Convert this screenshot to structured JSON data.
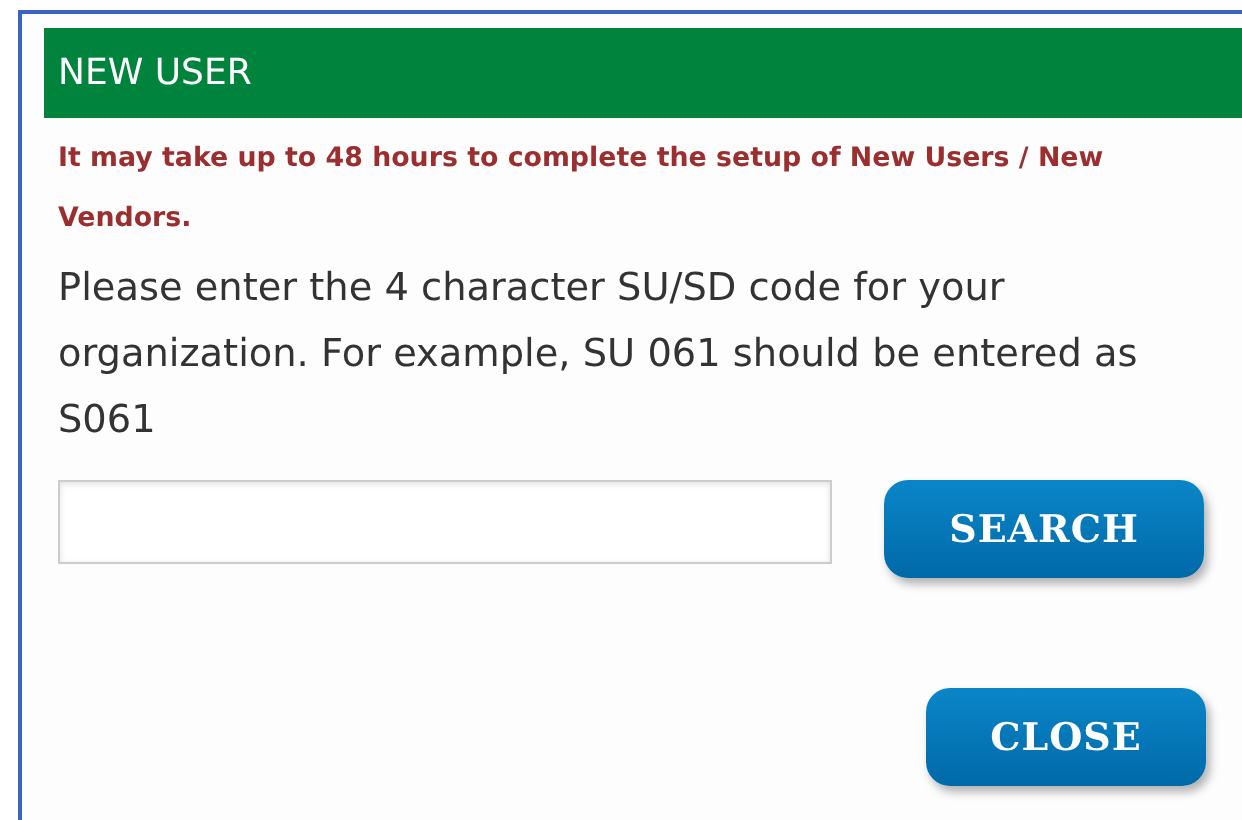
{
  "dialog": {
    "title": "NEW USER",
    "notice": "It may take up to 48 hours to complete the setup of New Users / New Vendors.",
    "instructions": "Please enter the 4 character SU/SD code for your organization. For example, SU 061 should be entered as S061",
    "search_button": "SEARCH",
    "close_button": "CLOSE"
  }
}
